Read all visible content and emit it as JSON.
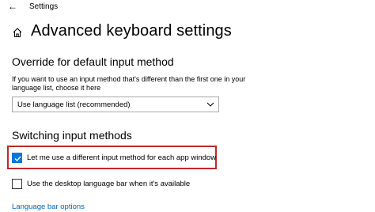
{
  "window": {
    "app_title": "Settings",
    "back_icon": "back-arrow-icon"
  },
  "header": {
    "home_icon": "home-icon",
    "title": "Advanced keyboard settings"
  },
  "override_section": {
    "heading": "Override for default input method",
    "description": "If you want to use an input method that's different than the first one in your language list, choose it here",
    "select": {
      "value": "Use language list (recommended)",
      "icon": "chevron-down-icon"
    }
  },
  "switching_section": {
    "heading": "Switching input methods",
    "options": [
      {
        "label": "Let me use a different input method for each app window",
        "checked": true
      },
      {
        "label": "Use the desktop language bar when it's available",
        "checked": false
      }
    ],
    "highlight_color": "#c0262d"
  },
  "language_bar_link": "Language bar options",
  "colors": {
    "accent": "#0078d7",
    "link": "#0067b8"
  }
}
